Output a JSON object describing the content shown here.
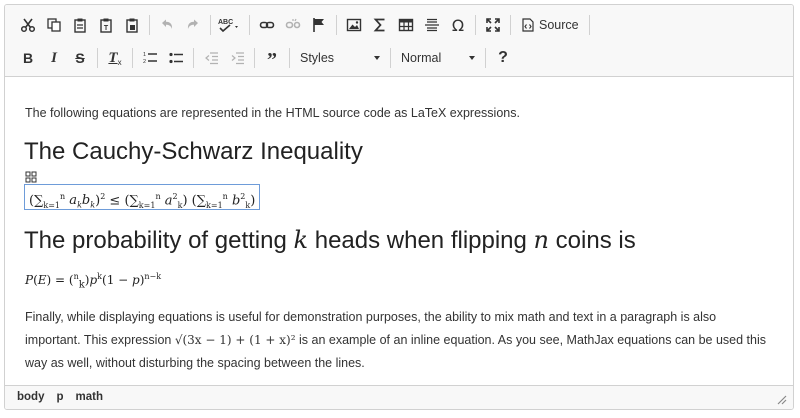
{
  "toolbar": {
    "source_label": "Source",
    "styles_label": "Styles",
    "format_label": "Normal",
    "help_label": "?",
    "bold_label": "B",
    "italic_label": "I",
    "strike_label": "S",
    "removeformat_label": "T"
  },
  "content": {
    "intro": "The following equations are represented in the HTML source code as LaTeX expressions.",
    "heading_cauchy": "The Cauchy-Schwarz Inequality",
    "heading_prob_a": "The probability of getting ",
    "heading_prob_k": "k",
    "heading_prob_b": " heads when flipping ",
    "heading_prob_n": "n",
    "heading_prob_c": " coins is",
    "para_part1": "Finally, while displaying equations is useful for demonstration purposes, the ability to mix math and text in a paragraph is also important. This expression ",
    "inline_math": "√(3x − 1) + (1 + x)²",
    "para_part2": " is an example of an inline equation. As you see, MathJax equations can be used this way as well, without disturbing the spacing between the lines."
  },
  "statusbar": {
    "path": [
      "body",
      "p",
      "math"
    ]
  }
}
